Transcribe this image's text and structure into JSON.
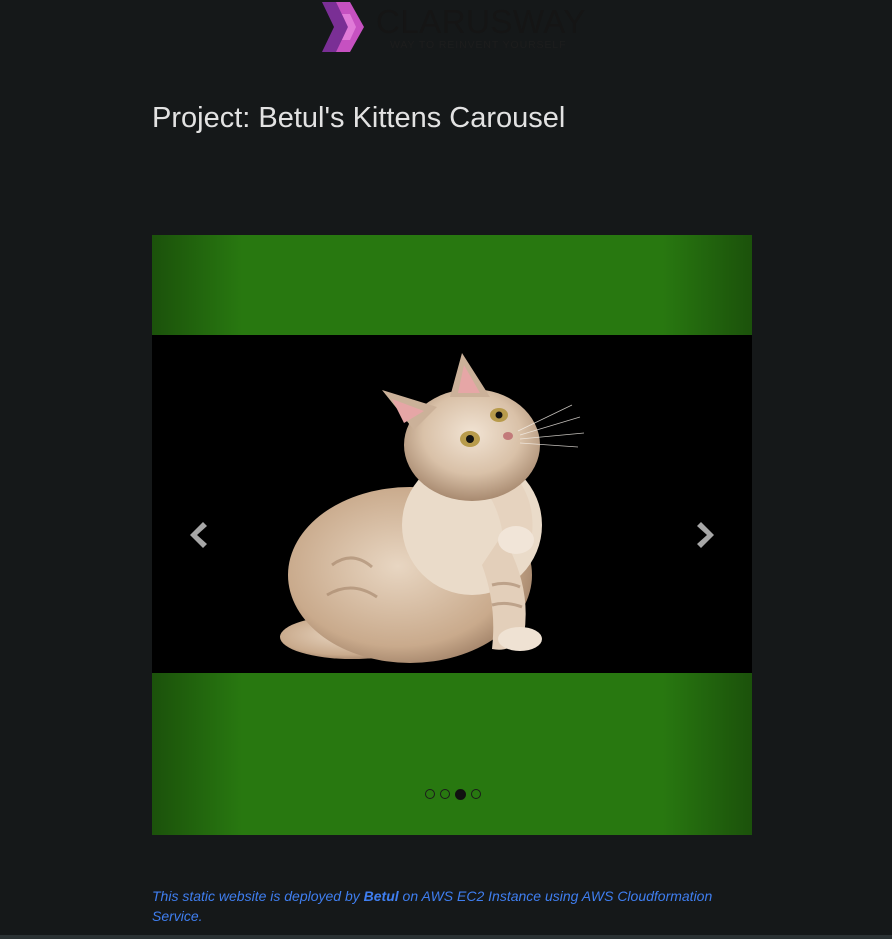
{
  "logo": {
    "title": "CLARUSWAY",
    "tagline": "WAY TO REINVENT YOURSELF",
    "colors": {
      "mark_dark": "#6a2a8c",
      "mark_light": "#c24fbf"
    }
  },
  "page_title": "Project: Betul's Kittens Carousel",
  "carousel": {
    "background_color": "#287810",
    "prev_icon": "chevron-left-icon",
    "next_icon": "chevron-right-icon",
    "slide_count": 4,
    "active_index": 2,
    "slide_image": "kitten-photo"
  },
  "footer": {
    "prefix": "This static website is deployed by ",
    "author": "Betul",
    "suffix": " on AWS EC2 Instance using AWS Cloudformation Service.",
    "color": "#3f7ef0"
  }
}
